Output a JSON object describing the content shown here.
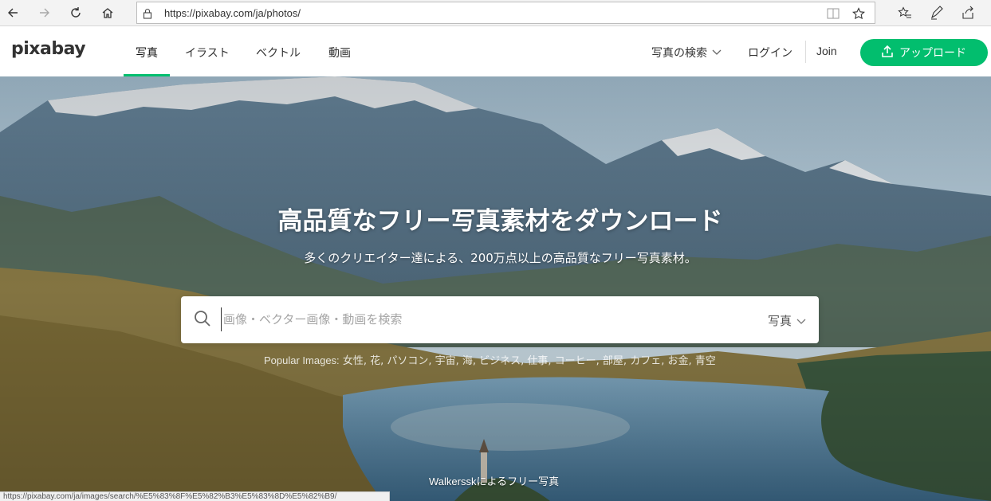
{
  "browser": {
    "url": "https://pixabay.com/ja/photos/",
    "status_url": "https://pixabay.com/ja/images/search/%E5%83%8F%E5%82%B3%E5%83%8D%E5%82%B9/"
  },
  "header": {
    "logo": "pixabay",
    "tabs": [
      {
        "label": "写真",
        "active": true
      },
      {
        "label": "イラスト",
        "active": false
      },
      {
        "label": "ベクトル",
        "active": false
      },
      {
        "label": "動画",
        "active": false
      }
    ],
    "search_menu": "写真の検索",
    "login": "ログイン",
    "join": "Join",
    "upload": "アップロード",
    "accent_color": "#02be6e"
  },
  "hero": {
    "title": "高品質なフリー写真素材をダウンロード",
    "subtitle": "多くのクリエイター達による、200万点以上の高品質なフリー写真素材。",
    "search": {
      "placeholder": "画像・ベクター画像・動画を検索",
      "type": "写真"
    },
    "popular_label": "Popular Images:",
    "popular_terms": "女性, 花, パソコン, 宇宙, 海, ビジネス, 仕事, コーヒー, 部屋, カフェ, お金, 青空",
    "credit_author": "Walkerssk",
    "credit_suffix": "によるフリー写真"
  }
}
